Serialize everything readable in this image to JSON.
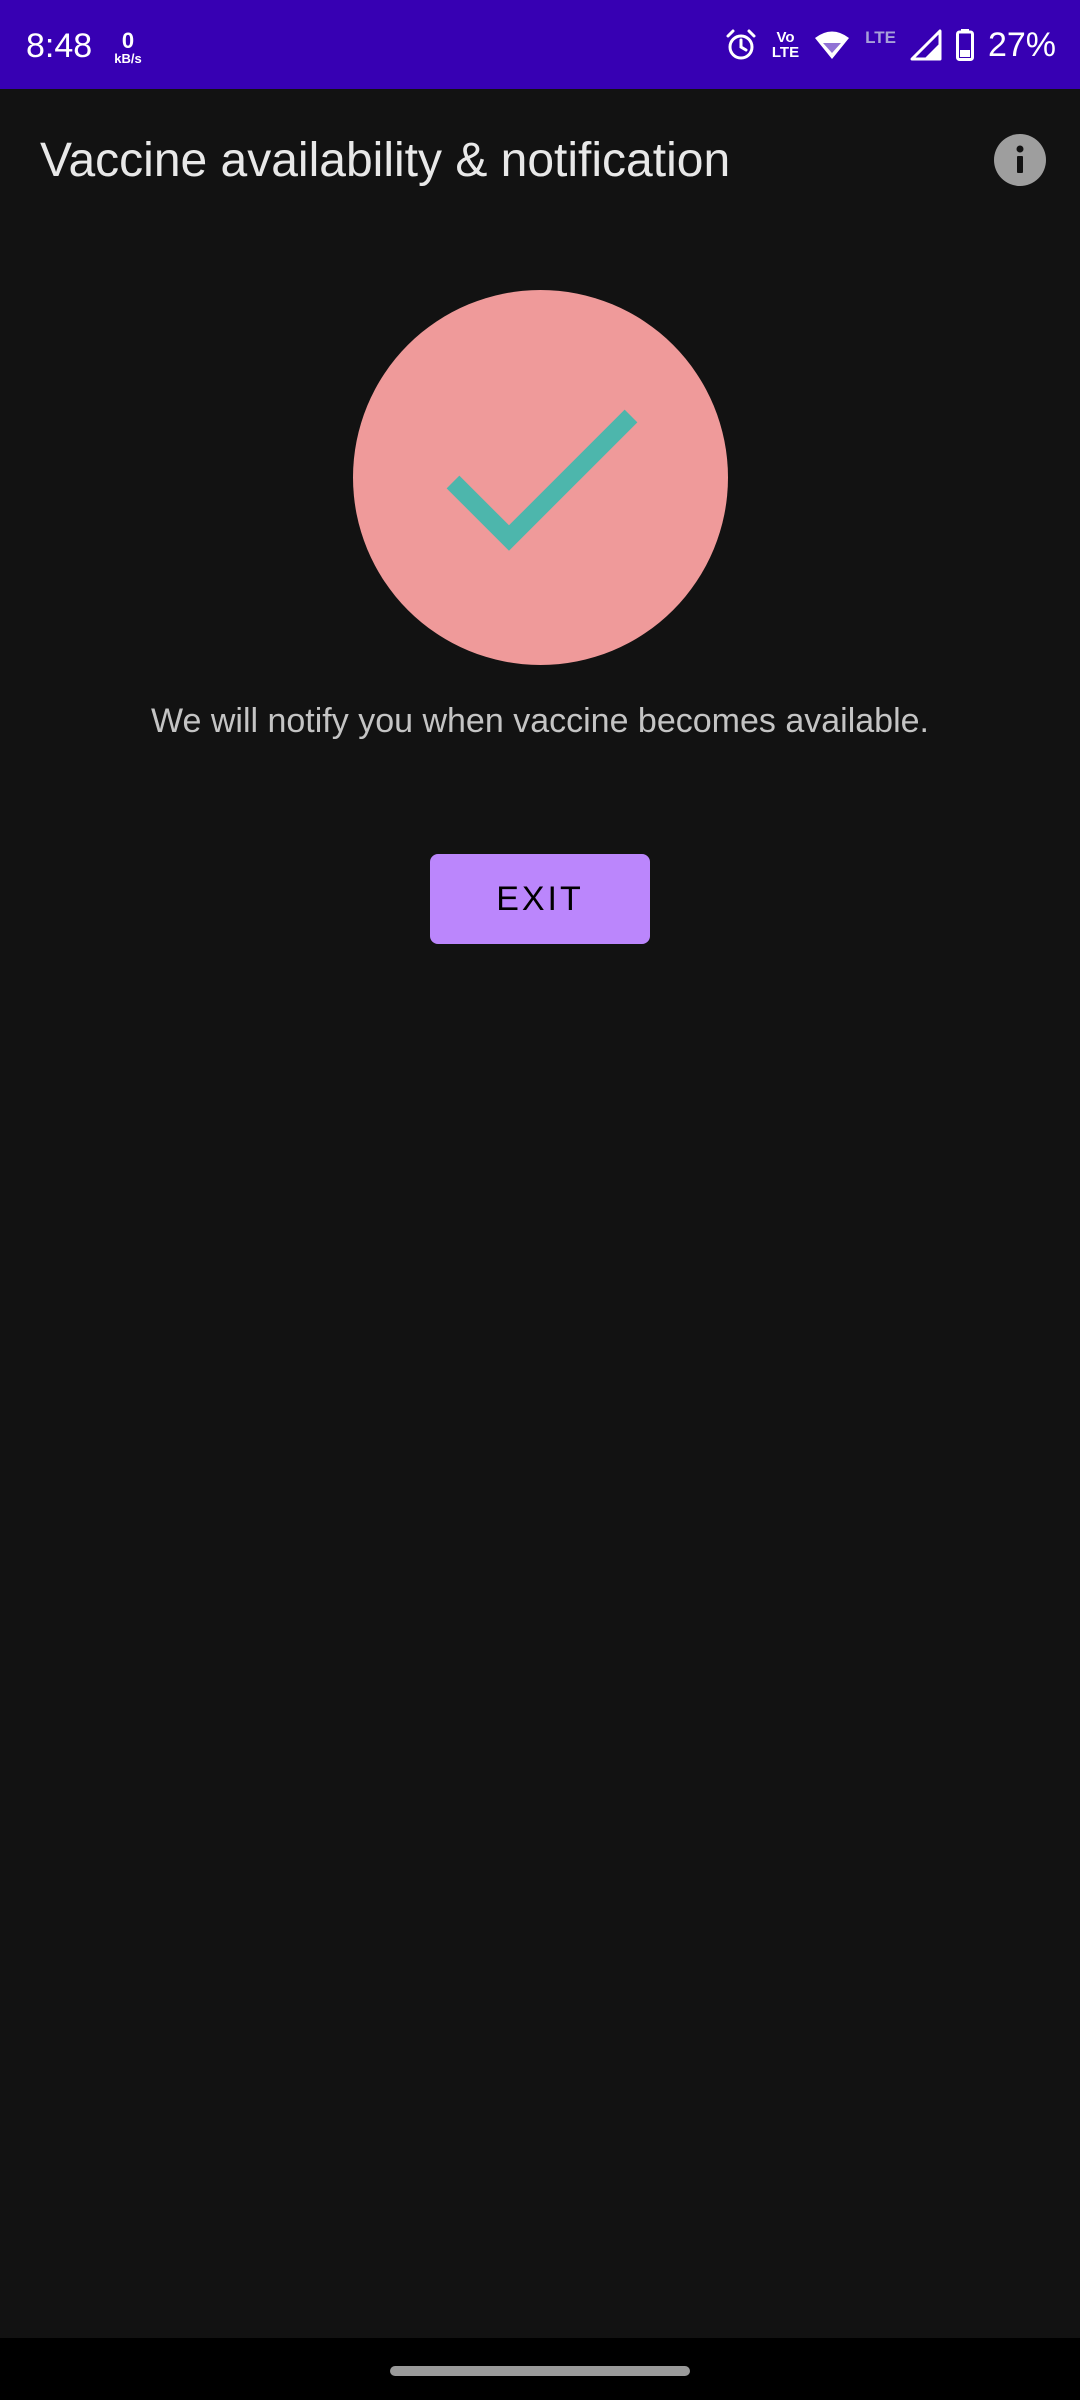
{
  "status_bar": {
    "time": "8:48",
    "net_speed_value": "0",
    "net_speed_unit": "kB/s",
    "volte_top": "Vo",
    "volte_bottom": "LTE",
    "network_type": "LTE",
    "battery_percent": "27%",
    "icons": [
      "alarm-icon",
      "volte-icon",
      "wifi-icon",
      "cell-signal-icon",
      "battery-icon"
    ],
    "background_color": "#3700b3"
  },
  "app_bar": {
    "title": "Vaccine availability & notification",
    "info_icon": "info-icon"
  },
  "confirmation": {
    "icon": "check-icon",
    "circle_color": "#ef9a9a",
    "check_color": "#4db6ac",
    "message": "We will notify you when vaccine becomes available."
  },
  "actions": {
    "exit_label": "EXIT",
    "exit_color": "#bb86fc"
  },
  "theme": {
    "background": "#121212"
  }
}
